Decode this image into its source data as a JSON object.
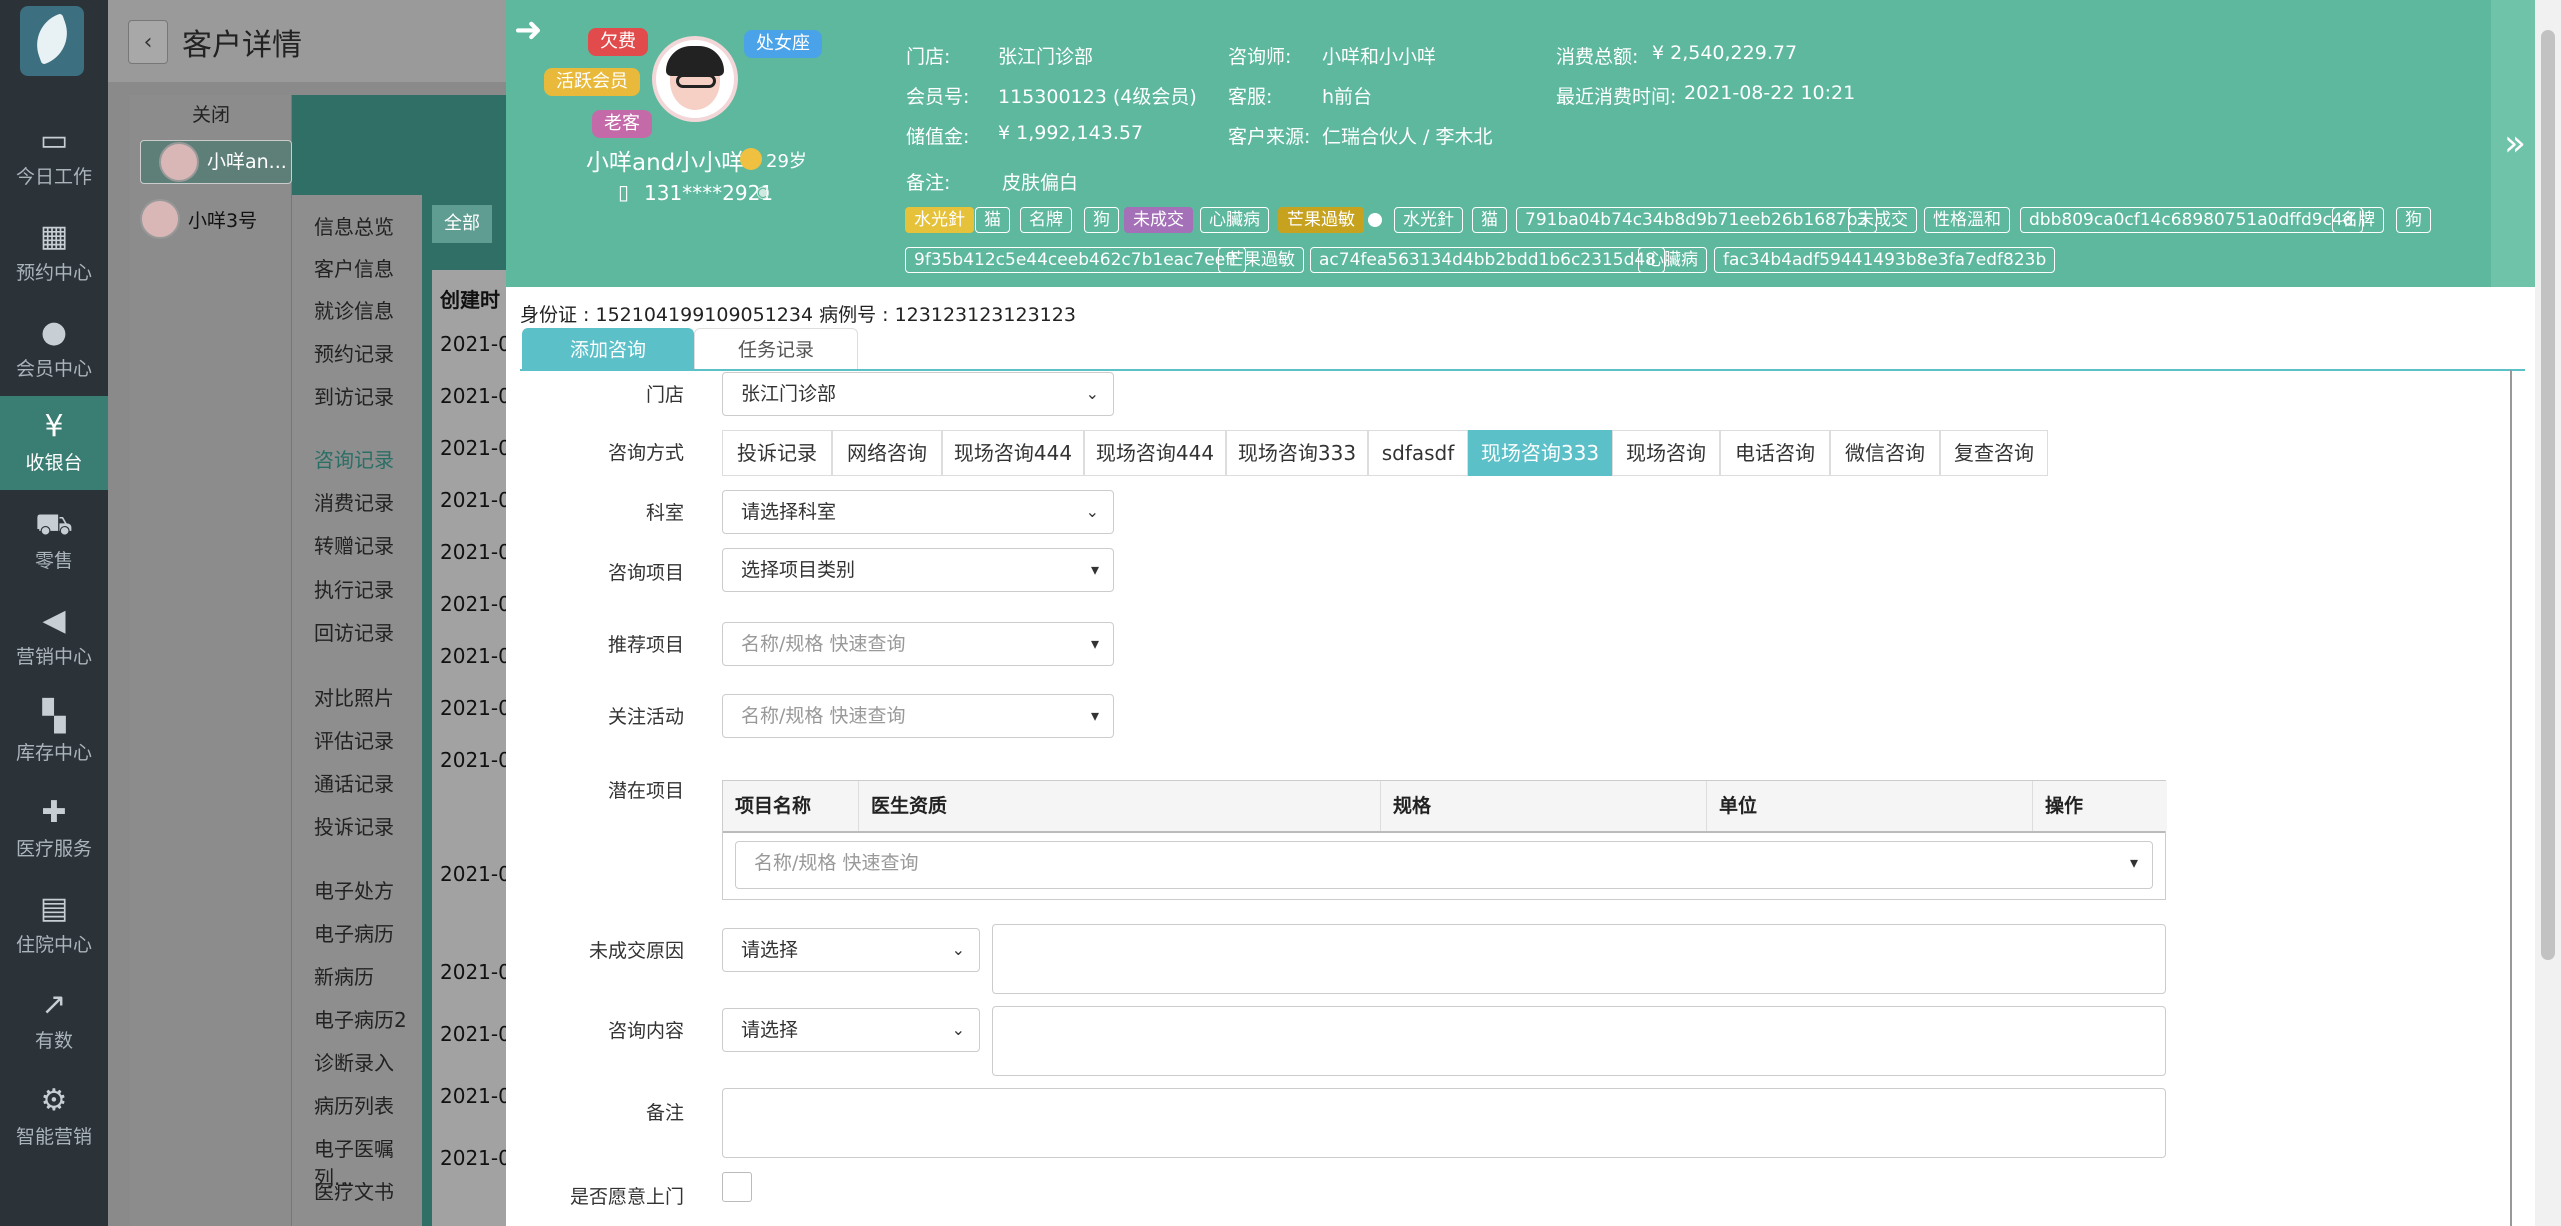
{
  "sidebar": {
    "items": [
      {
        "icon": "laptop-icon",
        "label": "今日工作"
      },
      {
        "icon": "calendar-icon",
        "label": "预约中心"
      },
      {
        "icon": "users-icon",
        "label": "会员中心"
      },
      {
        "icon": "yen-icon",
        "label": "收银台"
      },
      {
        "icon": "cart-icon",
        "label": "零售"
      },
      {
        "icon": "megaphone-icon",
        "label": "营销中心"
      },
      {
        "icon": "grid-icon",
        "label": "库存中心"
      },
      {
        "icon": "medkit-icon",
        "label": "医疗服务"
      },
      {
        "icon": "hospital-icon",
        "label": "住院中心"
      },
      {
        "icon": "chart-icon",
        "label": "有数"
      },
      {
        "icon": "smart-icon",
        "label": "智能营销"
      }
    ]
  },
  "page": {
    "title": "客户详情",
    "close": "关闭"
  },
  "bg_users": [
    "小咩an...",
    "小咩3号"
  ],
  "bg_menu": [
    "信息总览",
    "客户信息",
    "就诊信息",
    "预约记录",
    "到访记录",
    "咨询记录",
    "消费记录",
    "转赠记录",
    "执行记录",
    "回访记录",
    "对比照片",
    "评估记录",
    "通话记录",
    "投诉记录",
    "电子处方",
    "电子病历",
    "新病历",
    "电子病历2",
    "诊断录入",
    "病历列表",
    "电子医嘱列...",
    "医疗文书"
  ],
  "bg_table": {
    "all": "全部",
    "header": "创建时",
    "rows": [
      "2021-0",
      "2021-0",
      "2021-0",
      "2021-0",
      "2021-0",
      "2021-0",
      "2021-0",
      "2021-0",
      "2021-0",
      "2021-0",
      "2021-0",
      "2021-0",
      "2021-0",
      "2021-0"
    ]
  },
  "customer": {
    "badges": [
      "欠费",
      "处女座",
      "活跃会员",
      "老客"
    ],
    "name": "小咩and小小咩",
    "age": "29岁",
    "phone": "131****2921",
    "store_label": "门店:",
    "store": "张江门诊部",
    "member_label": "会员号:",
    "member": "115300123 (4级会员)",
    "balance_label": "储值金:",
    "balance": "¥ 1,992,143.57",
    "consultant_label": "咨询师:",
    "consultant": "小咩和小小咩",
    "service_label": "客服:",
    "service": "h前台",
    "source_label": "客户来源:",
    "source": "仁瑞合伙人 / 李木北",
    "total_label": "消费总额:",
    "total": "¥ 2,540,229.77",
    "last_label": "最近消费时间:",
    "last": "2021-08-22 10:21",
    "remark_label": "备注:",
    "remark": "皮肤偏白",
    "tags": [
      "水光針",
      "猫",
      "名牌",
      "狗",
      "未成交",
      "心臟病",
      "芒果過敏",
      "",
      "水光針",
      "猫",
      "791ba04b74c34b8d9b71eeb26b1687b3",
      "未成交",
      "性格溫和",
      "dbb809ca0cf14c68980751a0dffd9c4d",
      "名牌",
      "狗",
      "9f35b412c5e44ceeb462c7b1eac7eeff",
      "芒果過敏",
      "ac74fea563134d4bb2bdd1b6c2315d48",
      "心臟病",
      "fac34b4adf59441493b8e3fa7edf823b"
    ],
    "id_line": "身份证 : 152104199109051234   病例号 : 123123123123123"
  },
  "tabs": [
    "添加咨询",
    "任务记录"
  ],
  "form": {
    "store_label": "门店",
    "store_value": "张江门诊部",
    "method_label": "咨询方式",
    "methods": [
      "投诉记录",
      "网络咨询",
      "现场咨询444",
      "现场咨询444",
      "现场咨询333",
      "sdfasdf",
      "现场咨询333",
      "现场咨询",
      "电话咨询",
      "微信咨询",
      "复查咨询"
    ],
    "dept_label": "科室",
    "dept_value": "请选择科室",
    "item_label": "咨询项目",
    "item_value": "选择项目类别",
    "rec_label": "推荐项目",
    "rec_placeholder": "名称/规格 快速查询",
    "activity_label": "关注活动",
    "activity_placeholder": "名称/规格 快速查询",
    "potential_label": "潜在项目",
    "table_headers": [
      "项目名称",
      "医生资质",
      "规格",
      "单位",
      "操作"
    ],
    "table_placeholder": "名称/规格 快速查询",
    "reason_label": "未成交原因",
    "reason_value": "请选择",
    "content_label": "咨询内容",
    "content_value": "请选择",
    "note_label": "备注",
    "willing_label": "是否愿意上门"
  }
}
